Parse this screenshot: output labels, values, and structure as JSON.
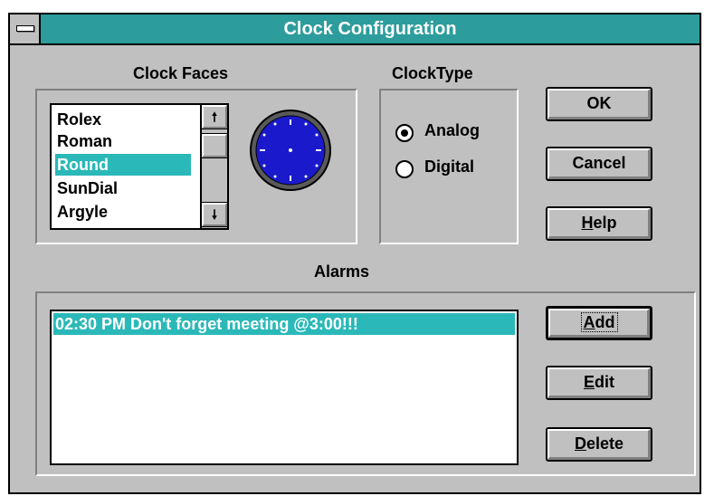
{
  "window": {
    "title": "Clock Configuration"
  },
  "clock_faces": {
    "label": "Clock Faces",
    "items": [
      "Rolex",
      "Roman",
      "Round",
      "SunDial",
      "Argyle"
    ],
    "selected": "Round"
  },
  "clock_type": {
    "label": "ClockType",
    "options": [
      {
        "label": "Analog",
        "selected": true
      },
      {
        "label": "Digital",
        "selected": false
      }
    ]
  },
  "buttons": {
    "ok": "OK",
    "cancel": "Cancel",
    "help_mnemonic": "H",
    "help_rest": "elp"
  },
  "alarms": {
    "label": "Alarms",
    "items": [
      "02:30 PM Don't forget meeting @3:00!!!"
    ],
    "add_mnemonic": "A",
    "add_rest": "dd",
    "edit_mnemonic": "E",
    "edit_rest": "dit",
    "delete_mnemonic": "D",
    "delete_rest": "elete"
  },
  "colors": {
    "titlebar": "#2d9c9c",
    "selection": "#2bb8b8",
    "face": "#c0c0c0",
    "clock_face": "#1a1acc"
  }
}
